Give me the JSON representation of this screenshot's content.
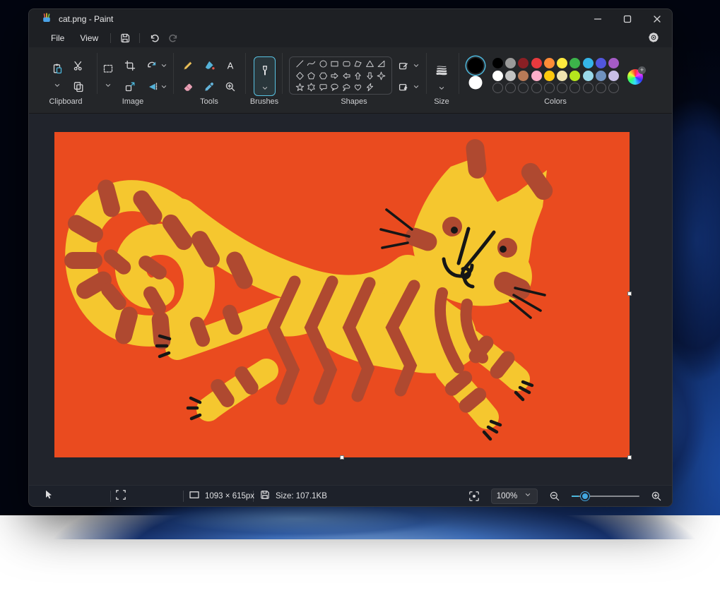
{
  "window": {
    "title": "cat.png - Paint"
  },
  "menu": {
    "items": [
      "File",
      "View"
    ]
  },
  "toolbar": {
    "group_labels": {
      "clipboard": "Clipboard",
      "image": "Image",
      "tools": "Tools",
      "brushes": "Brushes",
      "shapes": "Shapes",
      "size": "Size",
      "colors": "Colors"
    },
    "selected_tool": "brushes",
    "shapes": [
      "line",
      "curve",
      "oval",
      "rectangle",
      "rounded-rectangle",
      "polygon",
      "triangle",
      "right-triangle",
      "diamond",
      "pentagon",
      "hexagon",
      "arrow-right",
      "arrow-left",
      "arrow-up",
      "arrow-down",
      "four-point-star",
      "five-point-star",
      "six-point-star",
      "rounded-callout",
      "oval-callout",
      "cloud-callout",
      "heart",
      "lightning"
    ]
  },
  "colors": {
    "accent": "#4cb8dd",
    "primary": "#000000",
    "secondary": "#ffffff",
    "row1": [
      "#000000",
      "#9a9a9a",
      "#8b1f24",
      "#e83a3e",
      "#ff8c37",
      "#ffe93e",
      "#3cb44a",
      "#35b5e8",
      "#5156dd",
      "#a55bc6"
    ],
    "row2": [
      "#ffffff",
      "#c3c3c3",
      "#b97a57",
      "#ffaec9",
      "#ffc90e",
      "#efe4b0",
      "#b5e61d",
      "#99d9ea",
      "#7092be",
      "#c8bfe7"
    ],
    "empty_slots": 10
  },
  "canvas": {
    "colors": {
      "background": "#ea4b1f",
      "cat": "#f5c72f",
      "stripes": "#af4930",
      "details": "#161616"
    }
  },
  "statusbar": {
    "dimensions": "1093 × 615px",
    "file_size": "Size: 107.1KB",
    "zoom": "100%"
  }
}
